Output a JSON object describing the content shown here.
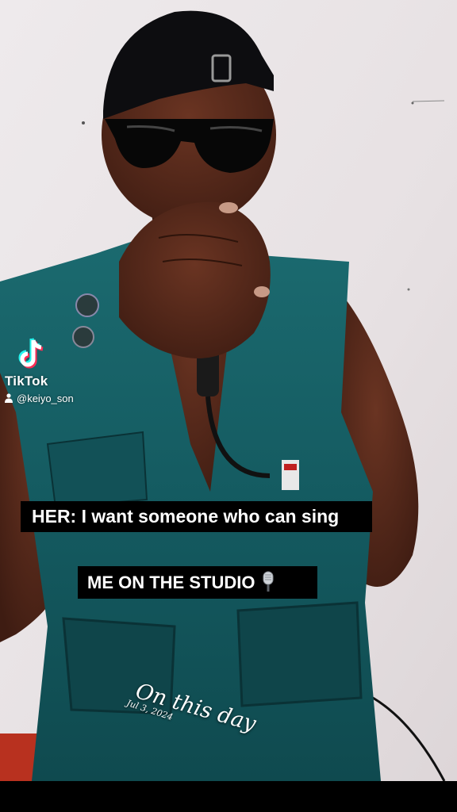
{
  "watermark": {
    "brand": "TikTok",
    "username": "@keiyo_son",
    "logo_icon": "tiktok-note-icon",
    "user_icon": "person-icon"
  },
  "captions": {
    "line1": "HER: I want someone who can sing",
    "line2": "ME ON THE STUDIO",
    "line2_emoji": "microphone-icon"
  },
  "memory": {
    "title": "On this day",
    "date": "Jul 3, 2024"
  },
  "colors": {
    "wall": "#e9e4e6",
    "vest": "#14575d",
    "skin": "#4a2418",
    "caption_bg": "#000000",
    "tiktok_cyan": "#25f4ee",
    "tiktok_red": "#fe2c55"
  }
}
